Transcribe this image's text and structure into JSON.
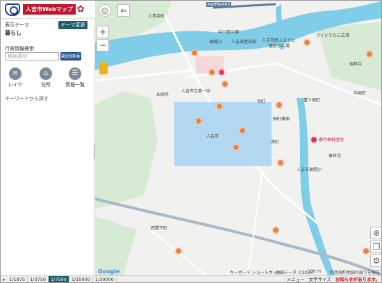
{
  "header": {
    "title": "人吉市Webマップ",
    "flower": "✿"
  },
  "side": {
    "theme_label": "表示テーマ",
    "theme_value": "暮らし",
    "theme_button": "テーマ変更 ▶",
    "search_label": "行政情報検索",
    "search_placeholder": "検索語句",
    "range_button": "範囲検索",
    "tools": [
      {
        "label": "レイヤ",
        "icon": "≡"
      },
      {
        "label": "住所",
        "icon": "⌂"
      },
      {
        "label": "情報一覧",
        "icon": "☰"
      }
    ],
    "keyword_hint": "キーワードから探す"
  },
  "map": {
    "labels": {
      "nhrte": "NatRte445",
      "kamiaoi": "上青井町",
      "nakagawara": "中川原公園",
      "kanzen": "観蔵川",
      "castle": "人吉城歴史館",
      "furusato": "人吉市民ふるさと",
      "furusato2": "歴史の広場",
      "ukerube": "うくいすたに広場",
      "zuiyoji": "瑞祥寺",
      "eikokuji": "永国寺",
      "kyoritsu": "人吉市立第一中",
      "tera": "寺町",
      "tomioka": "富ケ尾町",
      "nakamaru": "中尾町",
      "denda": "田町薬歯",
      "hitoyoshi": "人吉市",
      "minami": "南町",
      "kamiyama": "東林寺",
      "dental": "桑竹歯科医院",
      "civic": "人吉市東間小",
      "nishima": "西間下町",
      "google": "Google",
      "keyboard": "キーボード ショートカット",
      "mapdata": "地図データ ©2026",
      "scale100": "100 m",
      "terms": "利用規約",
      "report": "地図の誤りを報告する"
    }
  },
  "footer": {
    "scales": [
      "1/1875",
      "1/3750",
      "1/7500",
      "1/15000",
      "1/30000"
    ],
    "active_scale": 2,
    "menu": "メニュー",
    "font_size": "文字サイズ",
    "notice": "お知らせがあります。"
  },
  "colors": {
    "accent": "#1f5c6e",
    "brand": "#c0162c",
    "river": "#7fcde8",
    "highlight": "#a8d4f2"
  }
}
